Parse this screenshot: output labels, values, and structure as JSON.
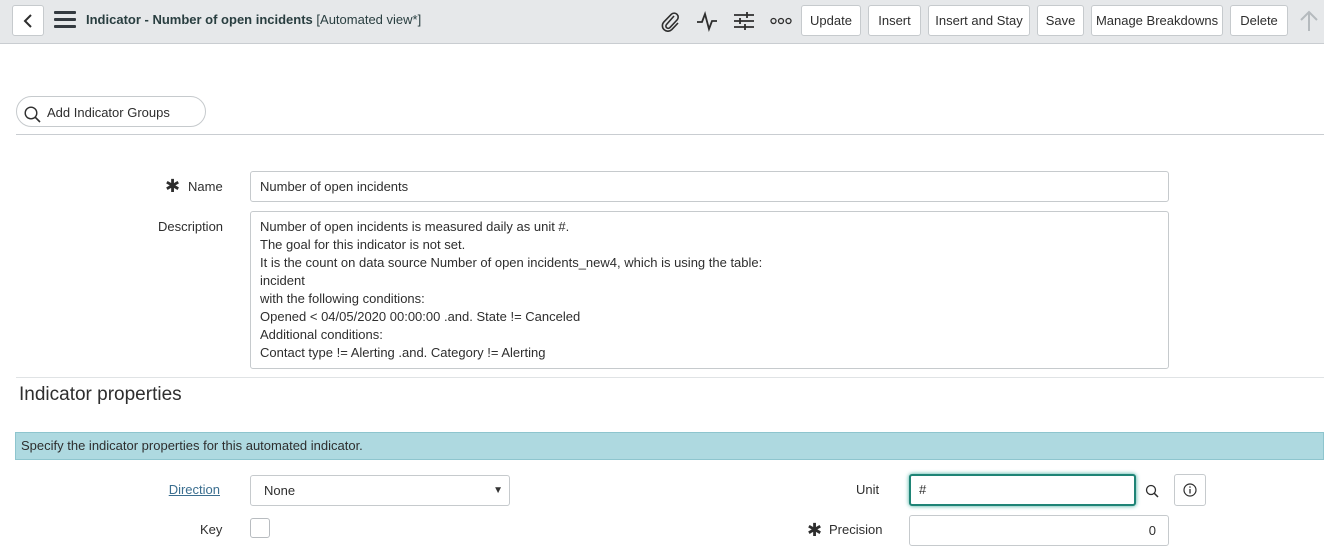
{
  "header": {
    "title": "Indicator - Number of open incidents",
    "view": "[Automated view*]",
    "icons": [
      "chevron-left-icon",
      "hamburger-menu-icon",
      "paperclip-icon",
      "activity-icon",
      "sliders-icon",
      "more-icon",
      "arrow-up-icon"
    ],
    "buttons": {
      "update": "Update",
      "insert": "Insert",
      "insert_and_stay": "Insert and Stay",
      "save": "Save",
      "manage_breakdowns": "Manage Breakdowns",
      "delete": "Delete"
    }
  },
  "tags": {
    "placeholder": "Add Indicator Groups"
  },
  "form": {
    "name_label": "Name",
    "name_value": "Number of open incidents",
    "description_label": "Description",
    "description_value": "Number of open incidents is measured daily as unit #.\nThe goal for this indicator is not set.\nIt is the count on data source Number of open incidents_new4, which is using the table:\nincident\nwith the following conditions:\nOpened < 04/05/2020 00:00:00 .and. State != Canceled\nAdditional conditions:\nContact type != Alerting .and. Category != Alerting"
  },
  "section": {
    "title": "Indicator properties",
    "info": "Specify the indicator properties for this automated indicator.",
    "direction_label": "Direction",
    "direction_value": "None",
    "unit_label": "Unit",
    "unit_value": "#",
    "key_label": "Key",
    "key_checked": false,
    "precision_label": "Precision",
    "precision_value": "0"
  }
}
